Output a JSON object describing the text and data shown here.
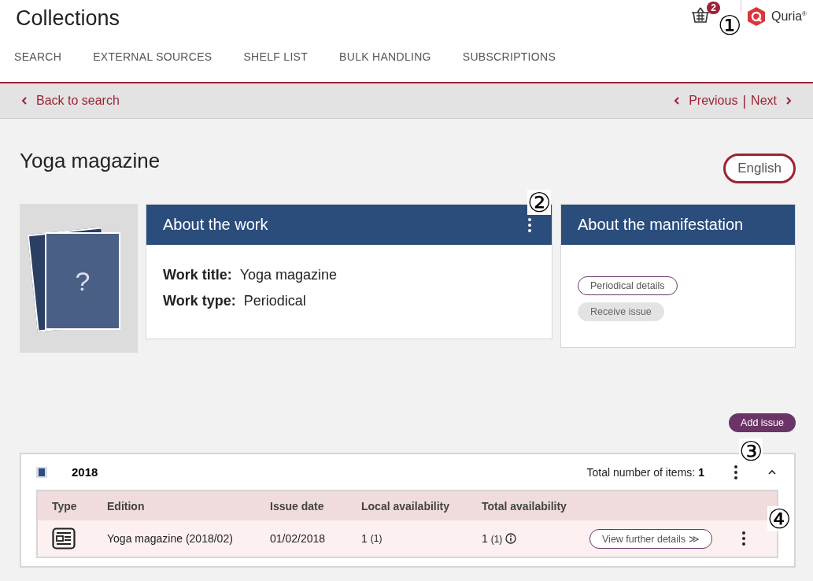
{
  "header": {
    "title": "Collections",
    "basket_count": "2",
    "logo_text": "Quria",
    "logo_mark": "®"
  },
  "tabs": [
    {
      "label": "SEARCH",
      "selected": false
    },
    {
      "label": "EXTERNAL SOURCES",
      "selected": false
    },
    {
      "label": "SHELF LIST",
      "selected": false
    },
    {
      "label": "BULK HANDLING",
      "selected": false
    },
    {
      "label": "SUBSCRIPTIONS",
      "selected": false
    }
  ],
  "nav": {
    "back": "Back to search",
    "previous": "Previous",
    "separator": "|",
    "next": "Next"
  },
  "page": {
    "title": "Yoga magazine",
    "language": "English",
    "cover_placeholder": "?"
  },
  "work_card": {
    "title": "About the work",
    "fields": [
      {
        "label": "Work title:",
        "value": "Yoga magazine"
      },
      {
        "label": "Work type:",
        "value": "Periodical"
      }
    ]
  },
  "manifestation_card": {
    "title": "About the manifestation",
    "buttons": [
      {
        "label": "Periodical details",
        "disabled": false
      },
      {
        "label": "Receive issue",
        "disabled": true
      }
    ]
  },
  "add_issue": "Add issue",
  "year_panel": {
    "year": "2018",
    "total_label": "Total number of items:",
    "total": "1",
    "expanded": true,
    "columns": [
      "Type",
      "Edition",
      "Issue date",
      "Local availability",
      "Total availability"
    ],
    "rows": [
      {
        "edition": "Yoga magazine (2018/02)",
        "issue_date": "01/02/2018",
        "local": "1",
        "local_sub": "(1)",
        "total": "1",
        "total_sub": "(1)",
        "details": "View further details ≫"
      }
    ]
  },
  "callouts": [
    "①",
    "②",
    "③",
    "④"
  ]
}
